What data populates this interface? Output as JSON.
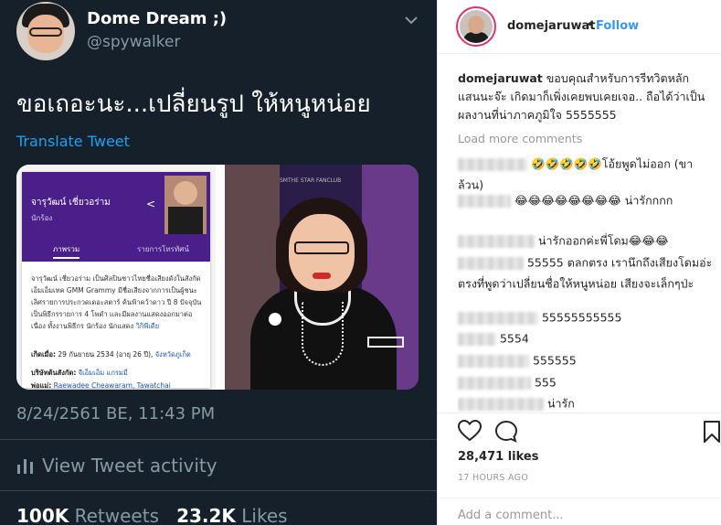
{
  "tweet": {
    "display_name": "Dome Dream ;)",
    "handle": "@spywalker",
    "text": "ขอเถอะนะ...เปลี่ยนรูป ให้หนูหน่อย",
    "translate_label": "Translate Tweet",
    "timestamp": "8/24/2561 BE, 11:43 PM",
    "activity_label": "View Tweet activity",
    "retweets_count": "100K",
    "retweets_label": "Retweets",
    "likes_count": "23.2K",
    "likes_label": "Likes",
    "colors": {
      "background": "#15202b",
      "link": "#1da1f2",
      "muted": "#8899a6"
    },
    "media": {
      "card_name": "จารุวัฒน์ เชี่ยวอร่าม",
      "card_role": "นักร้อง",
      "tab_overview": "ภาพรวม",
      "tab_programs": "รายการโทรทัศน์",
      "card_body": "จารุวัฒน์ เชี่ยวอร่าม เป็นศิลปินชาวไทยชื่อเสียงดังในสังกัด เอ็มเอ็มเทค GMM Grammy มีชื่อเสียงจากการเป็นผู้ชนะเลิศรายการประกวดเดอะสตาร์ ค้นฟ้าคว้าดาว ปี 8 ปัจจุบันเป็นพิธีกรรายการ 4 โพดำ และมีผลงานแสดงออกมาต่อเนื่อง ทั้งงานพิธีกร นักร้อง นักแสดง",
      "card_body_link": "วิกิพีเดีย",
      "born_label": "เกิดเมื่อ:",
      "born_value": "29 กันยายน 2534 (อายุ 26 ปี),",
      "born_place": "จังหวัดภูเก็ต",
      "company_label": "บริษัทต้นสังกัด:",
      "company_value": "จีเอ็มเอ็ม แกรมมี่",
      "sibling_label": "พ่อแม่:",
      "sibling_value": "Raewadee Cheawaram, Tawatchai",
      "watermark": "SMTHE STAR FANCLUB"
    }
  },
  "instagram": {
    "username": "domejaruwat",
    "dot": "•",
    "follow_label": "Follow",
    "caption": "ขอบคุณสำหรับการรีทวิตหลัก แสนนะจ๊ะ เกิดมาก็เพิ่งเคยพบเคยเจอ.. ถือได้ว่าเป็นผลงานที่น่าภาคภูมิใจ 5555555",
    "load_more": "Load more comments",
    "comments": [
      {
        "text": "🤣🤣🤣🤣🤣โอ้ยพูดไม่ออก (ขาล้วน)"
      },
      {
        "text": "😂😂😂😂😂😂😂😂 น่ารักกกก"
      },
      {
        "text": "น่ารักออกค่ะพี่โดม😂😂😂"
      },
      {
        "text": "55555 ตลกตรง เรานึกถึงเสียงโดมอ่ะ ตรงที่พูดว่าเปลี่ยนชื่อให้หนูหน่อย เสียงจะเล็กๆป่ะ"
      },
      {
        "text": "55555555555"
      },
      {
        "text": "5554"
      },
      {
        "text": "555555"
      },
      {
        "text": "555"
      },
      {
        "text": "น่ารัก"
      }
    ],
    "likes": "28,471 likes",
    "time_ago": "17 HOURS AGO",
    "add_comment_placeholder": "Add a comment...",
    "colors": {
      "follow": "#3897f0",
      "ring": "#e1306c",
      "muted": "#999999"
    }
  }
}
